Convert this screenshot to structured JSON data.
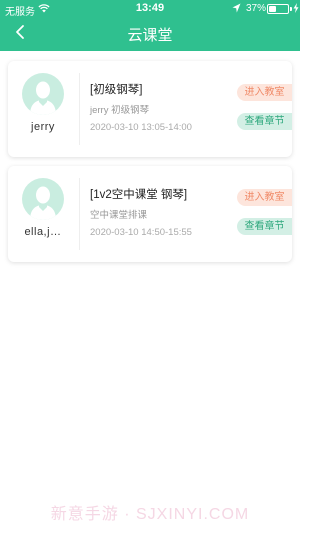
{
  "status_bar": {
    "carrier": "无服务",
    "time": "13:49",
    "battery_percent": "37%",
    "battery_level": 0.37
  },
  "header": {
    "title": "云课堂"
  },
  "courses": [
    {
      "teacher": "jerry",
      "course_name": "[初级钢琴]",
      "subtitle": "jerry 初级钢琴",
      "time_range": "2020-03-10 13:05-14:00",
      "enter_label": "进入教室",
      "chapter_label": "查看章节"
    },
    {
      "teacher": "ella,j…",
      "course_name": "[1v2空中课堂 钢琴]",
      "subtitle": "空中课堂排课",
      "time_range": "2020-03-10 14:50-15:55",
      "enter_label": "进入教室",
      "chapter_label": "查看章节"
    }
  ],
  "watermark": "新意手游 · SJXINYI.COM",
  "colors": {
    "primary": "#2fc08f",
    "enter_bg": "#fde5dc",
    "enter_text": "#f08a68",
    "chapter_bg": "#d3efe5",
    "chapter_text": "#2fa87d",
    "avatar_bg": "#c9ede0"
  },
  "icons": {
    "back": "chevron-left-icon",
    "wifi": "wifi-icon",
    "location": "location-arrow-icon",
    "battery": "battery-icon",
    "avatar": "user-avatar-icon"
  }
}
